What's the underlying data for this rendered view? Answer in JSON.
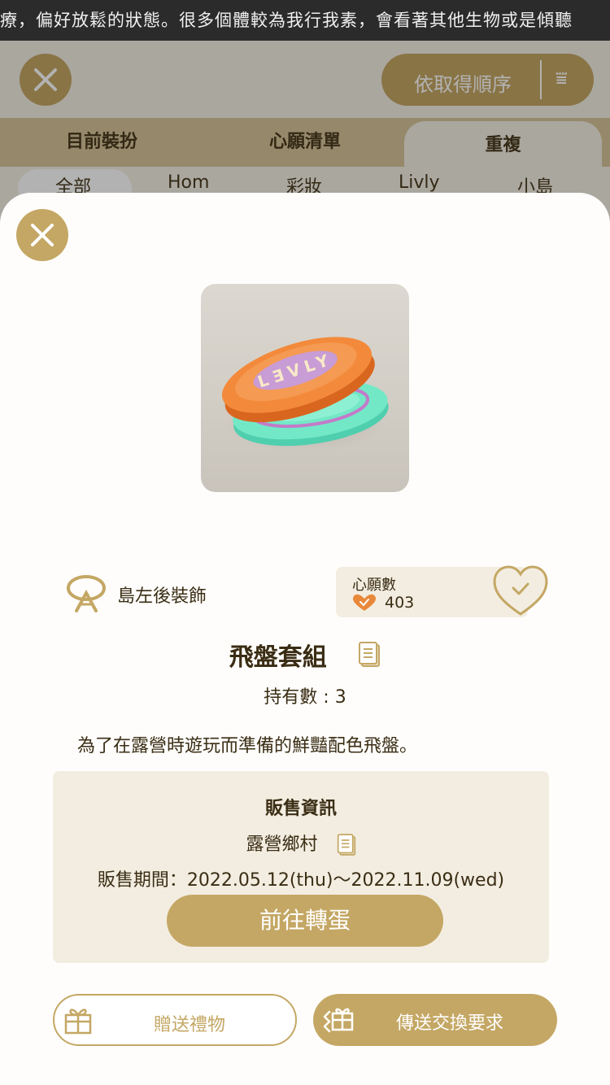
{
  "ticker": {
    "text": "療，偏好放鬆的狀態。很多個體較為我行我素，會看著其他生物或是傾聽"
  },
  "background": {
    "sort_label": "依取得順序",
    "tabs": [
      {
        "label": "目前裝扮"
      },
      {
        "label": "心願清單"
      },
      {
        "label": "重複"
      }
    ],
    "sub_tabs": [
      {
        "label": "全部"
      },
      {
        "label": "Hom"
      },
      {
        "label": "彩妝"
      },
      {
        "label": "Livly"
      },
      {
        "label": "小島"
      }
    ]
  },
  "item": {
    "category": "島左後裝飾",
    "wish_label": "心願數",
    "wish_count": "403",
    "name": "飛盤套組",
    "owned": "持有數 : 3",
    "description": "為了在露營時遊玩而準備的鮮豔配色飛盤。"
  },
  "sale": {
    "title": "販售資訊",
    "source": "露營鄉村",
    "period": "販售期間：2022.05.12(thu)～2022.11.09(wed)",
    "go_button": "前往轉蛋"
  },
  "actions": {
    "gift_label": "贈送禮物",
    "trade_label": "傳送交換要求"
  },
  "colors": {
    "accent": "#c4a764",
    "panel": "#f3ede1",
    "text": "#3a2d14",
    "wish_heart": "#e8893a"
  }
}
